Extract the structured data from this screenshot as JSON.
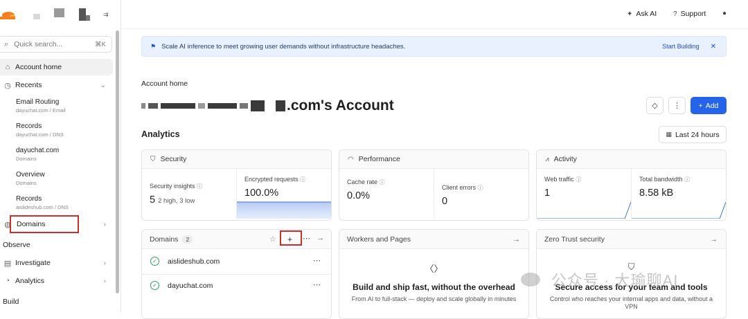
{
  "sidebar": {
    "search_placeholder": "Quick search...",
    "search_shortcut": "⌘K",
    "account_home": "Account home",
    "recents_label": "Recents",
    "recents": [
      {
        "title": "Email Routing",
        "sub": "dayuchat.com  /  Email"
      },
      {
        "title": "Records",
        "sub": "dayuchat.com  /  DNS"
      },
      {
        "title": "dayuchat.com",
        "sub": "Domains"
      },
      {
        "title": "Overview",
        "sub": "Domains"
      },
      {
        "title": "Records",
        "sub": "aislideshub.com  /  DNS"
      }
    ],
    "domains_label": "Domains",
    "observe_label": "Observe",
    "investigate_label": "Investigate",
    "analytics_label": "Analytics",
    "build_label": "Build"
  },
  "topbar": {
    "ask_ai": "Ask AI",
    "support": "Support"
  },
  "banner": {
    "text": "Scale AI inference to meet growing user demands without infrastructure headaches.",
    "cta": "Start Building"
  },
  "page": {
    "breadcrumb": "Account home",
    "account_title_suffix": ".com's Account",
    "add_label": "Add",
    "analytics_heading": "Analytics",
    "time_range": "Last 24 hours"
  },
  "cards": {
    "security": {
      "title": "Security",
      "insights_label": "Security insights",
      "insights_value": "5",
      "insights_note": "2 high, 3 low",
      "encrypted_label": "Encrypted requests",
      "encrypted_value": "100.0%"
    },
    "performance": {
      "title": "Performance",
      "cache_label": "Cache rate",
      "cache_value": "0.0%",
      "errors_label": "Client errors",
      "errors_value": "0"
    },
    "activity": {
      "title": "Activity",
      "traffic_label": "Web traffic",
      "traffic_value": "1",
      "bandwidth_label": "Total bandwidth",
      "bandwidth_value": "8.58 kB"
    }
  },
  "domains_card": {
    "title": "Domains",
    "count": "2",
    "items": [
      "aislideshub.com",
      "dayuchat.com"
    ]
  },
  "workers_card": {
    "title": "Workers and Pages",
    "headline": "Build and ship fast, without the overhead",
    "desc": "From AI to full-stack — deploy and scale globally in minutes"
  },
  "zero_trust_card": {
    "title": "Zero Trust security",
    "headline": "Secure access for your team and tools",
    "desc": "Control who reaches your internal apps and data, without a VPN"
  },
  "watermark": "公众号 · 大瑜聊AI",
  "colors": {
    "accent": "#2563eb",
    "banner_bg": "#e8f1fd",
    "highlight": "#c9302c",
    "success": "#2e9e5b"
  }
}
